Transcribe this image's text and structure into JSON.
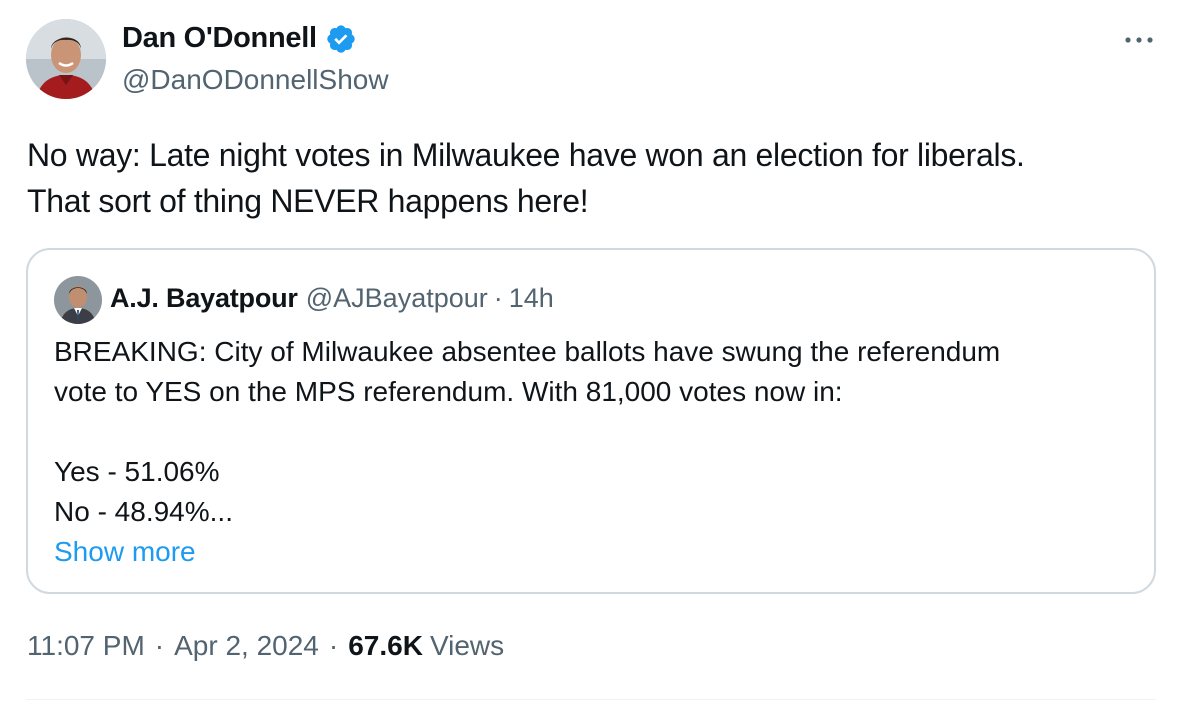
{
  "author": {
    "display_name": "Dan O'Donnell",
    "handle": "@DanODonnellShow",
    "verified": true,
    "avatar_icon": "avatar-photo"
  },
  "more_icon": "more-horizontal-icon",
  "tweet": {
    "text_lines": [
      "No way: Late night votes in Milwaukee have won an election for liberals.",
      "That sort of thing NEVER happens here!"
    ]
  },
  "quote": {
    "display_name": "A.J. Bayatpour",
    "handle": "@AJBayatpour",
    "separator": "·",
    "time": "14h",
    "lines": [
      "BREAKING: City of Milwaukee absentee ballots have swung the referendum",
      "vote to YES on the MPS referendum. With 81,000 votes now in:",
      "Yes - 51.06%",
      "No - 48.94%..."
    ],
    "show_more_label": "Show more"
  },
  "meta": {
    "time": "11:07 PM",
    "separator": "·",
    "date": "Apr 2, 2024",
    "views_count": "67.6K",
    "views_label": "Views"
  },
  "colors": {
    "text_primary": "#0f1419",
    "text_secondary": "#536471",
    "accent": "#1d9bf0",
    "border": "#cfd9de"
  }
}
